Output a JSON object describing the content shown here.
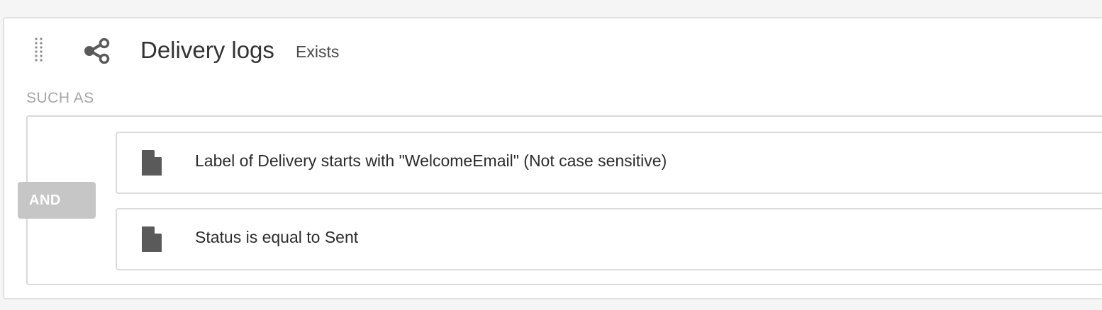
{
  "header": {
    "drag_icon": "drag-handle-icon",
    "link_icon": "share-link-icon",
    "title": "Delivery logs",
    "condition": "Exists"
  },
  "filter": {
    "such_as_label": "SUCH AS",
    "operator": "AND",
    "rules": [
      {
        "icon": "document-icon",
        "text": "Label of Delivery starts with \"WelcomeEmail\" (Not case sensitive)"
      },
      {
        "icon": "document-icon",
        "text": "Status is equal to Sent"
      }
    ]
  },
  "colors": {
    "background": "#f5f5f5",
    "card": "#ffffff",
    "badge": "#c6c6c6",
    "icon": "#5a5a5a"
  }
}
